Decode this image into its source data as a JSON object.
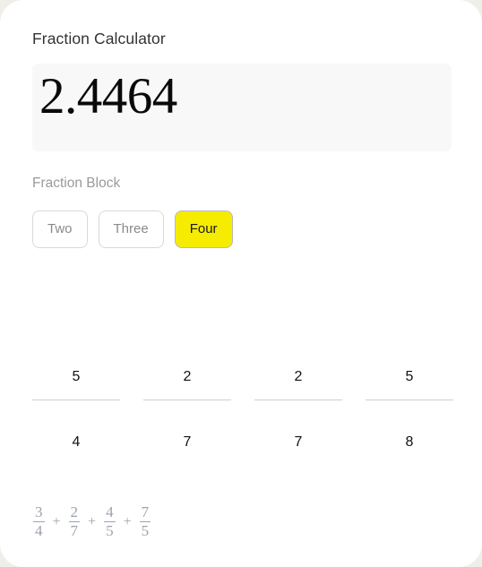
{
  "app": {
    "title": "Fraction Calculator",
    "card_background": "#ffffff",
    "page_background": "#efeee9"
  },
  "display": {
    "value": "2.4464",
    "background": "#f8f8f8"
  },
  "block_selector": {
    "label": "Fraction Block",
    "selected": "Four",
    "accent_color": "#f5ec00",
    "options": [
      {
        "label": "Two",
        "selected": false
      },
      {
        "label": "Three",
        "selected": false
      },
      {
        "label": "Four",
        "selected": true
      }
    ]
  },
  "fraction_inputs": [
    {
      "numerator": "5",
      "denominator": "4"
    },
    {
      "numerator": "2",
      "denominator": "7"
    },
    {
      "numerator": "2",
      "denominator": "7"
    },
    {
      "numerator": "5",
      "denominator": "8"
    }
  ],
  "formula": {
    "terms": [
      {
        "numerator": "3",
        "denominator": "4"
      },
      {
        "numerator": "2",
        "denominator": "7"
      },
      {
        "numerator": "4",
        "denominator": "5"
      },
      {
        "numerator": "7",
        "denominator": "5"
      }
    ],
    "operator": "+",
    "color": "#9da3ad"
  }
}
